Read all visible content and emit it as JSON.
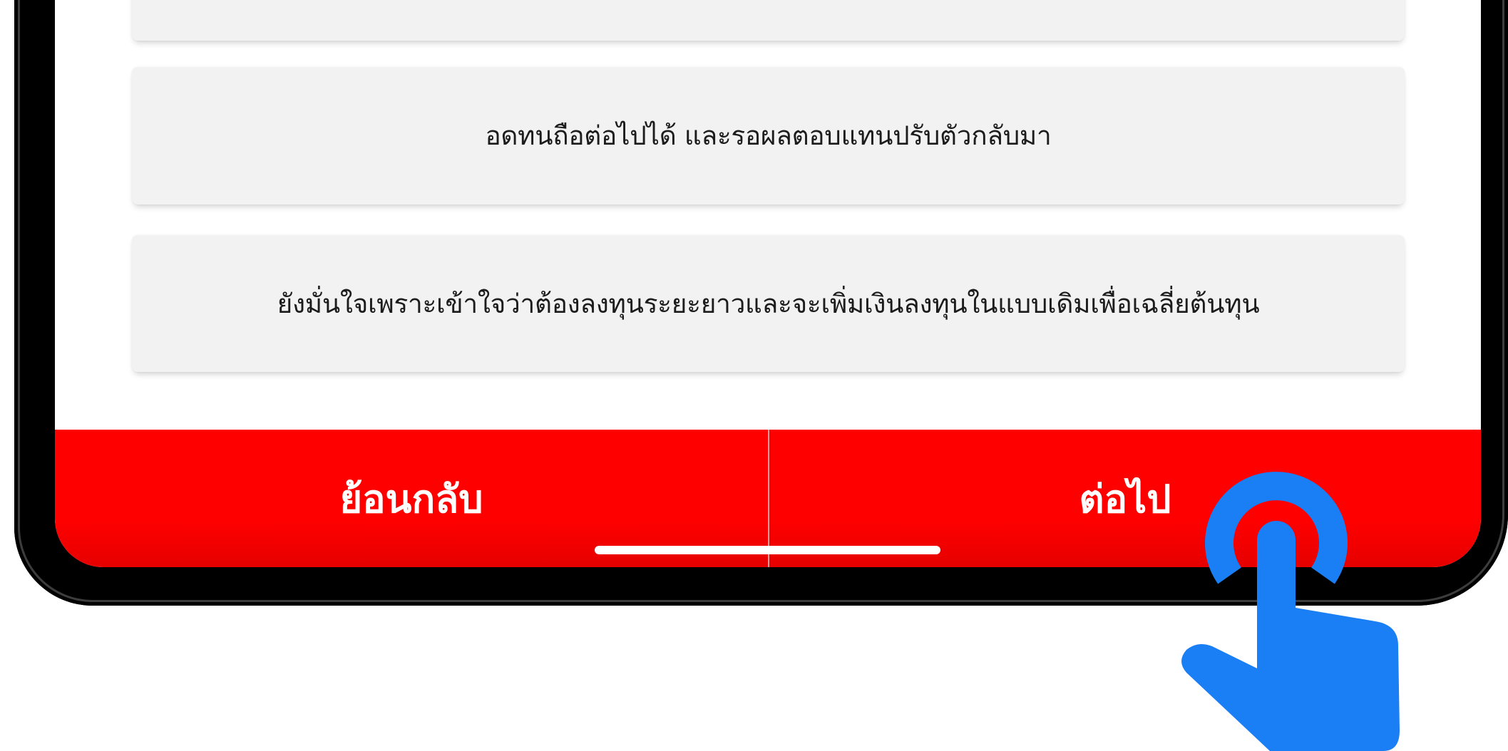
{
  "options": [
    {
      "label": "อดทนถือต่อไปได้ และรอผลตอบแทนปรับตัวกลับมา"
    },
    {
      "label": "ยังมั่นใจเพราะเข้าใจว่าต้องลงทุนระยะยาวและจะเพิ่มเงินลงทุนในแบบเดิมเพื่อเฉลี่ยต้นทุน"
    }
  ],
  "footer": {
    "back_label": "ย้อนกลับ",
    "next_label": "ต่อไป"
  },
  "icons": {
    "tap_gesture": "tap-hand-icon"
  },
  "colors": {
    "footer_bar": "#ff0000",
    "tap_icon": "#1a7ef5",
    "option_card": "#f2f2f2",
    "phone_frame": "#000000"
  }
}
